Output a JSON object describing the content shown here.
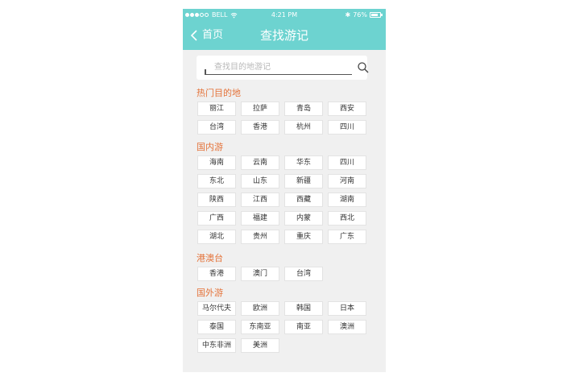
{
  "status_bar": {
    "carrier": "BELL",
    "time": "4:21 PM",
    "bluetooth": "✱",
    "battery_percent": "76%",
    "battery_level": 0.76
  },
  "nav": {
    "back_label": "首页",
    "title": "查找游记"
  },
  "search": {
    "placeholder": "查找目的地游记",
    "value": ""
  },
  "sections": [
    {
      "title": "热门目的地",
      "items": [
        "丽江",
        "拉萨",
        "青岛",
        "西安",
        "台湾",
        "香港",
        "杭州",
        "四川"
      ]
    },
    {
      "title": "国内游",
      "items": [
        "海南",
        "云南",
        "华东",
        "四川",
        "东北",
        "山东",
        "新疆",
        "河南",
        "陕西",
        "江西",
        "西藏",
        "湖南",
        "广西",
        "福建",
        "内蒙",
        "西北",
        "湖北",
        "贵州",
        "重庆",
        "广东"
      ]
    },
    {
      "title": "港澳台",
      "items": [
        "香港",
        "澳门",
        "台湾"
      ]
    },
    {
      "title": "国外游",
      "items": [
        "马尔代夫",
        "欧洲",
        "韩国",
        "日本",
        "泰国",
        "东南亚",
        "南亚",
        "澳洲",
        "中东非洲",
        "美洲"
      ]
    }
  ],
  "colors": {
    "header": "#6dd3d0",
    "section_title": "#e4733a",
    "background": "#f0f0f0"
  }
}
